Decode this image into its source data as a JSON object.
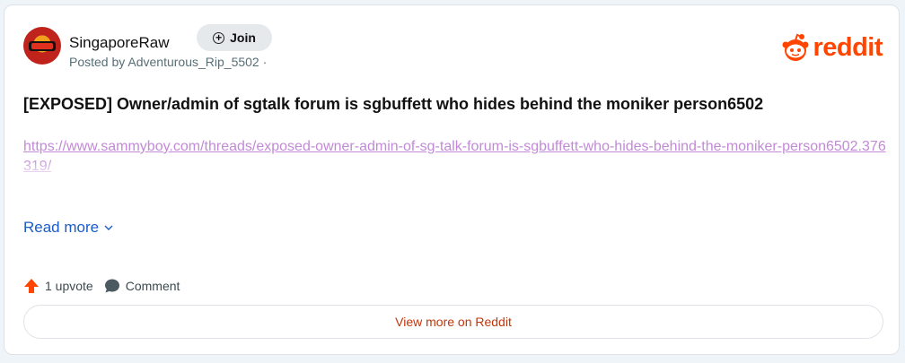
{
  "post": {
    "subreddit": "SingaporeRaw",
    "join_label": "Join",
    "posted_by": "Posted by Adventurous_Rip_5502 ·",
    "logo_text": "reddit",
    "title": "[EXPOSED] Owner/admin of sgtalk forum is sgbuffett who hides behind the moniker person6502",
    "link": "https://www.sammyboy.com/threads/exposed-owner-admin-of-sg-talk-forum-is-sgbuffett-who-hides-behind-the-moniker-person6502.376319/",
    "read_more": "Read more",
    "upvotes": "1 upvote",
    "comment": "Comment",
    "view_more": "View more on Reddit"
  },
  "colors": {
    "brand": "#ff4500",
    "link": "#c28ad7",
    "read_more": "#1a5cc8"
  }
}
